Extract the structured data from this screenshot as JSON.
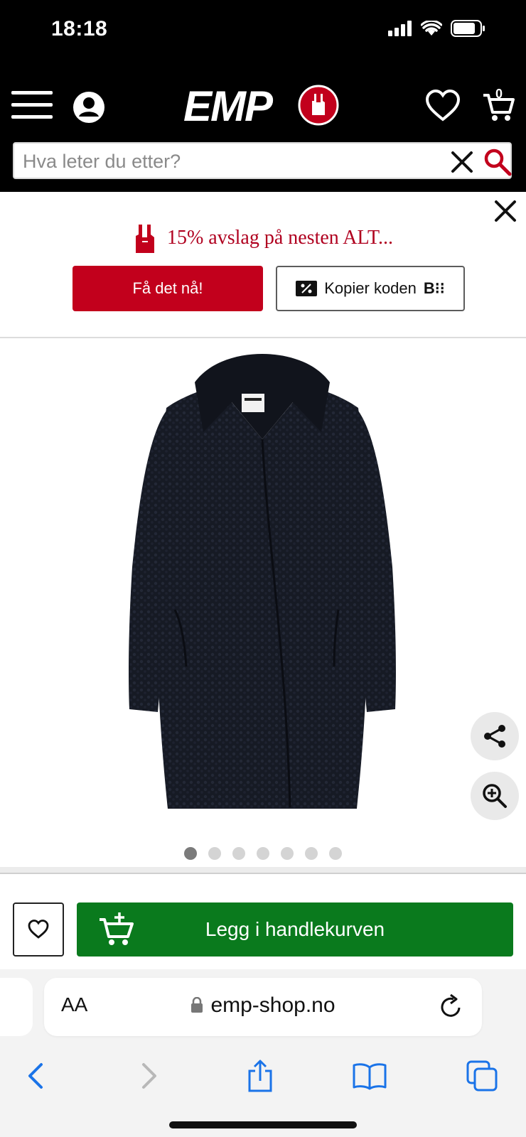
{
  "status_bar": {
    "time": "18:18"
  },
  "header": {
    "logo_text": "EMP",
    "cart_count": "0",
    "icons": [
      "menu-icon",
      "user-icon",
      "heart-icon",
      "cart-icon"
    ]
  },
  "search": {
    "placeholder": "Hva leter du etter?",
    "value": ""
  },
  "promo": {
    "text": "15% avslag på nesten ALT...",
    "get_label": "Få det nå!",
    "copy_label": "Kopier koden",
    "code_preview": "B⁝⁝",
    "accent_color": "#c2001c"
  },
  "product": {
    "image_count": 7,
    "active_image": 1,
    "wishlist_icon": "heart-outline-icon",
    "add_to_cart_label": "Legg i handlekurven",
    "add_to_cart_color": "#0a7a1d"
  },
  "browser": {
    "text_size_label": "AA",
    "url": "emp-shop.no"
  }
}
